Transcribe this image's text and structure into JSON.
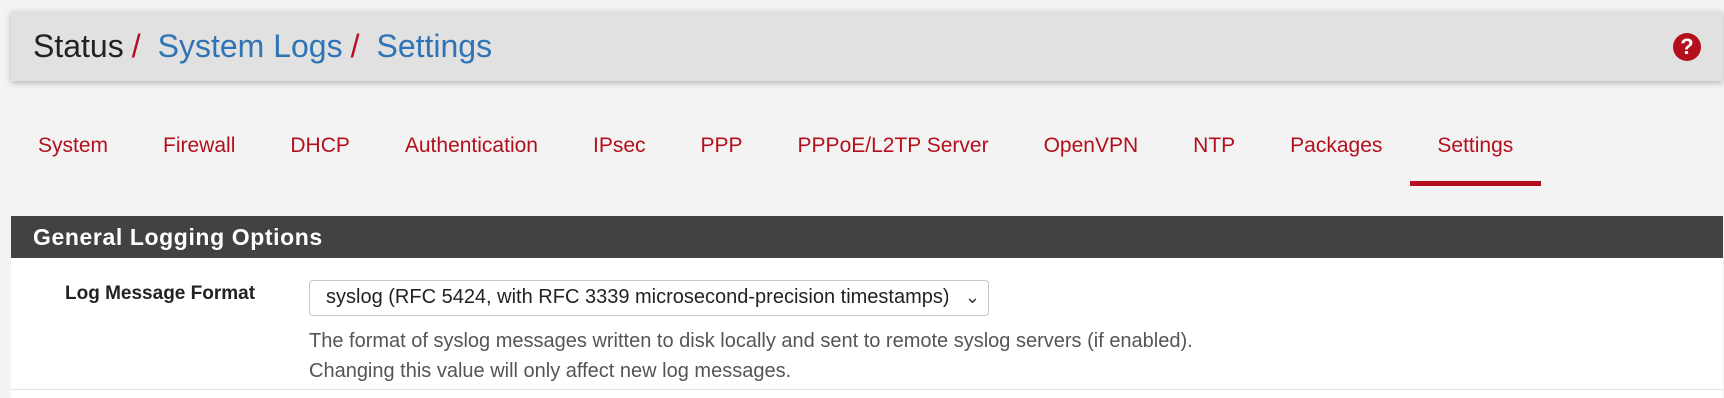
{
  "breadcrumb": {
    "root": "Status",
    "separator": "/",
    "items": [
      "System Logs",
      "Settings"
    ]
  },
  "help_icon": "question-circle-icon",
  "tabs": [
    {
      "label": "System"
    },
    {
      "label": "Firewall"
    },
    {
      "label": "DHCP"
    },
    {
      "label": "Authentication"
    },
    {
      "label": "IPsec"
    },
    {
      "label": "PPP"
    },
    {
      "label": "PPPoE/L2TP Server"
    },
    {
      "label": "OpenVPN"
    },
    {
      "label": "NTP"
    },
    {
      "label": "Packages"
    },
    {
      "label": "Settings",
      "active": true
    }
  ],
  "panel": {
    "heading": "General Logging Options",
    "log_message_format": {
      "label": "Log Message Format",
      "selected": "syslog (RFC 5424, with RFC 3339 microsecond-precision timestamps)",
      "help_line1": "The format of syslog messages written to disk locally and sent to remote syslog servers (if enabled).",
      "help_line2": "Changing this value will only affect new log messages."
    }
  },
  "colors": {
    "accent": "#b30f1c",
    "link": "#2f74b5",
    "panel_heading_bg": "#424242"
  }
}
